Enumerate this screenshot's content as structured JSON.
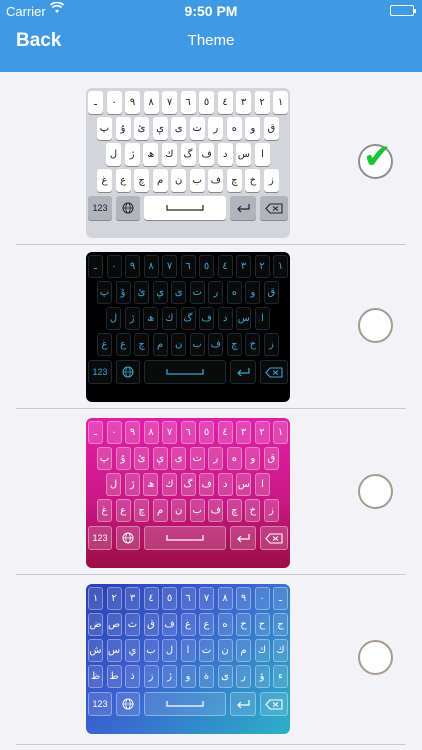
{
  "status_bar": {
    "carrier": "Carrier",
    "time": "9:50 PM"
  },
  "nav": {
    "back_label": "Back",
    "title": "Theme"
  },
  "keyboard": {
    "rows": [
      [
        "ـ",
        "٠",
        "٩",
        "٨",
        "٧",
        "٦",
        "٥",
        "٤",
        "٣",
        "٢",
        "١"
      ],
      [
        "پ",
        "ۇ",
        "ئ",
        "ې",
        "ى",
        "ت",
        "ر",
        "ە",
        "و",
        "ق"
      ],
      [
        "ل",
        "ژ",
        "ھ",
        "ك",
        "گ",
        "ف",
        "د",
        "س",
        "ا"
      ],
      [
        "غ",
        "ع",
        "چ",
        "م",
        "ن",
        "ب",
        "ف",
        "چ",
        "خ",
        "ز"
      ]
    ],
    "num_label": "123"
  },
  "keyboard_blue": {
    "rows": [
      [
        "١",
        "٢",
        "٣",
        "٤",
        "٥",
        "٦",
        "٧",
        "٨",
        "٩",
        "٠",
        "ـ"
      ],
      [
        "ض",
        "ص",
        "ث",
        "ق",
        "ف",
        "غ",
        "ع",
        "ه",
        "خ",
        "ح",
        "ج"
      ],
      [
        "ش",
        "س",
        "ي",
        "ب",
        "ل",
        "ا",
        "ت",
        "ن",
        "م",
        "ك",
        "ك"
      ],
      [
        "ظ",
        "ط",
        "ذ",
        "ز",
        "ژ",
        "و",
        "ة",
        "ى",
        "ر",
        "ؤ",
        "ء"
      ]
    ]
  },
  "themes": [
    {
      "name": "white",
      "selected": true
    },
    {
      "name": "black",
      "selected": false
    },
    {
      "name": "pink",
      "selected": false
    },
    {
      "name": "blue",
      "selected": false
    }
  ]
}
